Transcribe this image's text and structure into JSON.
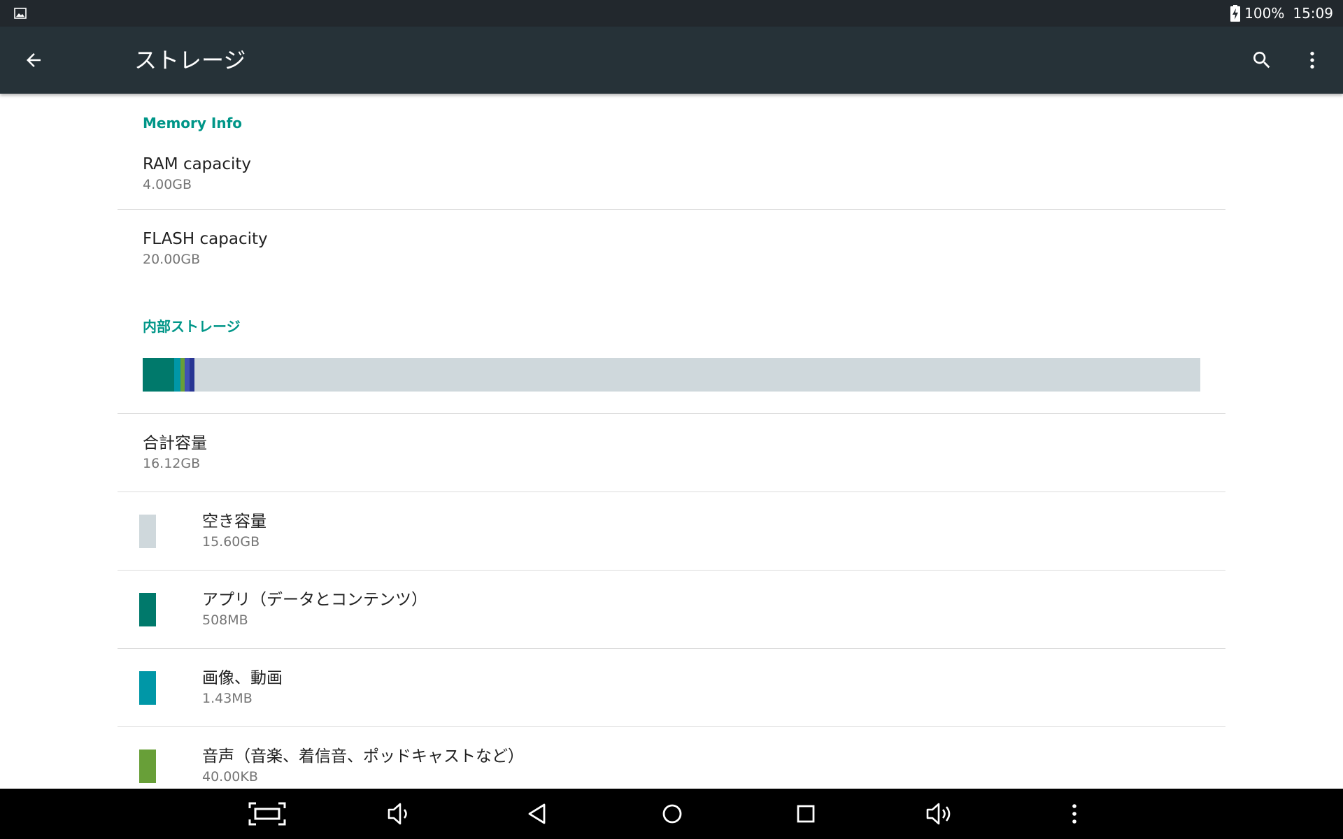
{
  "status_bar": {
    "battery_percent": "100%",
    "time": "15:09",
    "left_icon": "image-notification-icon",
    "battery_icon": "battery-charging-icon"
  },
  "app_bar": {
    "title": "ストレージ",
    "back_icon": "arrow-back-icon",
    "search_icon": "search-icon",
    "more_icon": "more-vert-icon",
    "color": "#263238"
  },
  "memory_info": {
    "header": "Memory Info",
    "ram": {
      "title": "RAM capacity",
      "value": "4.00GB"
    },
    "flash": {
      "title": "FLASH capacity",
      "value": "20.00GB"
    }
  },
  "internal_storage": {
    "header": "内部ストレージ",
    "usage_bar": {
      "background_color": "#cfd8dc",
      "segments": [
        {
          "name": "apps",
          "fraction": 0.03,
          "color": "#00796b"
        },
        {
          "name": "images",
          "fraction": 0.006,
          "color": "#0097a7"
        },
        {
          "name": "audio",
          "fraction": 0.004,
          "color": "#689f38"
        },
        {
          "name": "downloads",
          "fraction": 0.004,
          "color": "#3f51b5"
        },
        {
          "name": "misc",
          "fraction": 0.005,
          "color": "#283593"
        }
      ]
    },
    "total": {
      "title": "合計容量",
      "value": "16.12GB"
    },
    "items": [
      {
        "title": "空き容量",
        "value": "15.60GB",
        "color": "#cfd8dc"
      },
      {
        "title": "アプリ（データとコンテンツ）",
        "value": "508MB",
        "color": "#00796b"
      },
      {
        "title": "画像、動画",
        "value": "1.43MB",
        "color": "#0097a7"
      },
      {
        "title": "音声（音楽、着信音、ポッドキャストなど）",
        "value": "40.00KB",
        "color": "#689f38"
      }
    ]
  },
  "nav_bar": {
    "buttons": [
      "screenshot-icon",
      "volume-down-icon",
      "back-triangle-icon",
      "home-circle-icon",
      "recents-square-icon",
      "volume-up-icon",
      "more-vert-icon"
    ]
  },
  "accent_color": "#009688"
}
